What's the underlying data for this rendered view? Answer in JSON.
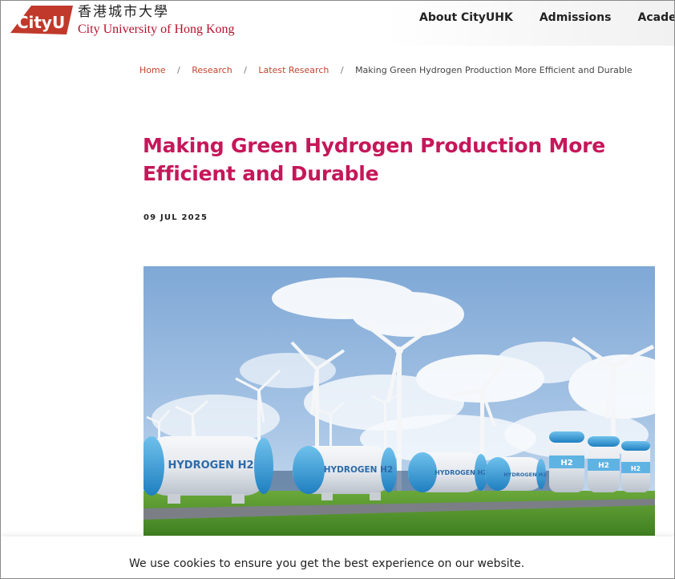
{
  "header": {
    "logo_mark": "CityU",
    "logo_chinese": "香港城市大學",
    "logo_english": "City University of Hong Kong",
    "nav": [
      "About CityUHK",
      "Admissions",
      "Academic"
    ]
  },
  "breadcrumb": {
    "items": [
      "Home",
      "Research",
      "Latest Research"
    ],
    "current": "Making Green Hydrogen Production More Efficient and Durable",
    "separator": "/"
  },
  "article": {
    "title": "Making Green Hydrogen Production More Efficient and Durable",
    "date": "09 JUL 2025",
    "hero_image": {
      "tank_labels": [
        "HYDROGEN H2",
        "HYDROGEN H2",
        "HYDROGEN H2",
        "HYDROGEN H2"
      ],
      "small_tank_labels": [
        "H2",
        "H2",
        "H2"
      ]
    }
  },
  "cookie_banner": {
    "text": "We use cookies to ensure you get the best experience on our website."
  },
  "colors": {
    "brand_red": "#b5122c",
    "title_magenta": "#c5175a",
    "breadcrumb_link": "#c2452f"
  }
}
